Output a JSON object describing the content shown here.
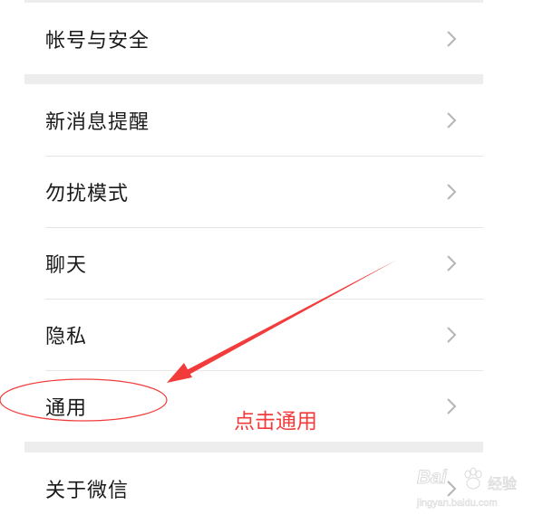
{
  "settings": {
    "groups": [
      {
        "items": [
          {
            "label": "帐号与安全"
          }
        ]
      },
      {
        "items": [
          {
            "label": "新消息提醒"
          },
          {
            "label": "勿扰模式"
          },
          {
            "label": "聊天"
          },
          {
            "label": "隐私"
          },
          {
            "label": "通用"
          }
        ]
      },
      {
        "items": [
          {
            "label": "关于微信"
          }
        ]
      }
    ]
  },
  "annotation": {
    "callout_text": "点击通用",
    "color": "#f23c3c"
  },
  "watermark": {
    "brand": "Bai",
    "product": "经验",
    "domain": "jingyan.baidu.com"
  },
  "icons": {
    "row_chevron": "chevron-right-icon",
    "watermark_logo": "baidu-paw-icon"
  }
}
